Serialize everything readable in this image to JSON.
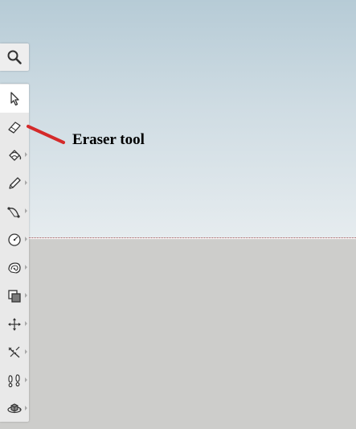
{
  "canvas": {
    "sky_colors": [
      "#b6cbd6",
      "#e6ecef"
    ],
    "ground_color": "#cdcdcb",
    "horizon_color": "#a04848"
  },
  "search_panel": {
    "icon": "search-icon"
  },
  "toolbar": {
    "selected_tool": "select-tool",
    "tools": [
      {
        "name": "select-tool",
        "icon": "arrow-cursor-icon",
        "has_flyout": false
      },
      {
        "name": "eraser-tool",
        "icon": "eraser-icon",
        "has_flyout": false
      },
      {
        "name": "paint-bucket-tool",
        "icon": "paint-bucket-icon",
        "has_flyout": true
      },
      {
        "name": "line-tool",
        "icon": "pencil-icon",
        "has_flyout": true
      },
      {
        "name": "arc-tool",
        "icon": "arc-icon",
        "has_flyout": true
      },
      {
        "name": "circle-tool",
        "icon": "circle-icon",
        "has_flyout": true
      },
      {
        "name": "push-pull-tool",
        "icon": "push-pull-icon",
        "has_flyout": true
      },
      {
        "name": "offset-tool",
        "icon": "offset-icon",
        "has_flyout": true
      },
      {
        "name": "move-tool",
        "icon": "move-icon",
        "has_flyout": true
      },
      {
        "name": "tape-measure-tool",
        "icon": "tape-measure-icon",
        "has_flyout": true
      },
      {
        "name": "walk-tool",
        "icon": "footprints-icon",
        "has_flyout": true
      },
      {
        "name": "orbit-tool",
        "icon": "orbit-icon",
        "has_flyout": true
      }
    ]
  },
  "annotation": {
    "label": "Eraser tool",
    "arrow_color": "#d42a2a"
  }
}
